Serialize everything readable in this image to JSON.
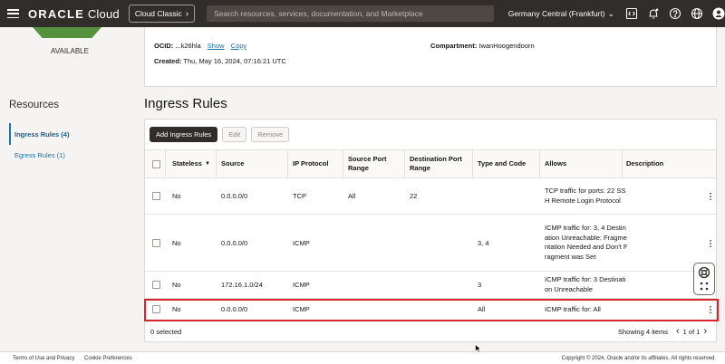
{
  "topbar": {
    "logo_brand": "ORACLE",
    "logo_product": " Cloud",
    "cloud_classic_label": "Cloud Classic",
    "search_placeholder": "Search resources, services, documentation, and Marketplace",
    "region": "Germany Central (Frankfurt)",
    "icons": [
      "code-editor-icon",
      "bell-icon",
      "help-icon",
      "globe-icon",
      "user-icon"
    ]
  },
  "status": {
    "label": "AVAILABLE",
    "color": "#56913d"
  },
  "info": {
    "ocid_label": "OCID:",
    "ocid_value": "...k26hla",
    "show_link": "Show",
    "copy_link": "Copy",
    "compartment_label": "Compartment:",
    "compartment_value": "IwanHoogendoorn",
    "created_label": "Created:",
    "created_value": "Thu, May 16, 2024, 07:16:21 UTC"
  },
  "resources": {
    "title": "Resources",
    "items": [
      {
        "label": "Ingress Rules (4)",
        "active": true
      },
      {
        "label": "Egress Rules (1)",
        "active": false
      }
    ]
  },
  "ingress": {
    "title": "Ingress Rules",
    "buttons": {
      "add": "Add Ingress Rules",
      "edit": "Edit",
      "remove": "Remove"
    },
    "columns": {
      "stateless": "Stateless",
      "source": "Source",
      "ip_protocol": "IP Protocol",
      "source_port_range": "Source Port Range",
      "destination_port_range": "Destination Port Range",
      "type_and_code": "Type and Code",
      "allows": "Allows",
      "description": "Description"
    },
    "rows": [
      {
        "stateless": "No",
        "source": "0.0.0.0/0",
        "protocol": "TCP",
        "src_port": "All",
        "dst_port": "22",
        "type_code": "",
        "allows": "TCP traffic for ports: 22 SSH Remote Login Protocol",
        "description": ""
      },
      {
        "stateless": "No",
        "source": "0.0.0.0/0",
        "protocol": "ICMP",
        "src_port": "",
        "dst_port": "",
        "type_code": "3, 4",
        "allows": "ICMP traffic for: 3, 4 Destination Unreachable: Fragmentation Needed and Don't Fragment was Set",
        "description": ""
      },
      {
        "stateless": "No",
        "source": "172.16.1.0/24",
        "protocol": "ICMP",
        "src_port": "",
        "dst_port": "",
        "type_code": "3",
        "allows": "ICMP traffic for: 3 Destination Unreachable",
        "description": ""
      },
      {
        "stateless": "No",
        "source": "0.0.0.0/0",
        "protocol": "ICMP",
        "src_port": "",
        "dst_port": "",
        "type_code": "All",
        "allows": "ICMP traffic for: All",
        "description": ""
      }
    ],
    "selected_count": "0 selected",
    "showing": "Showing 4 items",
    "page": "1 of 1"
  },
  "footer": {
    "terms": "Terms of Use and Privacy",
    "cookies": "Cookie Preferences",
    "copyright": "Copyright © 2024, Oracle and/or its affiliates. All rights reserved."
  },
  "colors": {
    "topbar": "#312d2a",
    "link": "#1a73a8",
    "highlight": "#d9232e",
    "primary_button": "#312d2a"
  }
}
